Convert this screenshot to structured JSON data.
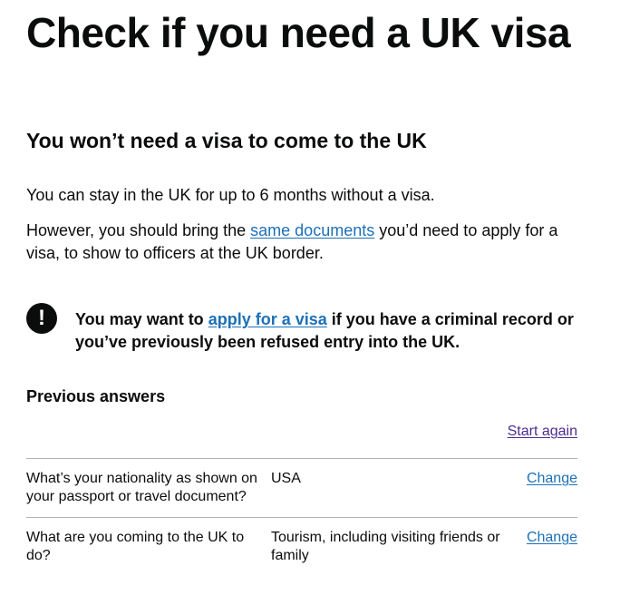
{
  "page": {
    "title": "Check if you need a UK visa"
  },
  "outcome": {
    "title": "You won’t need a visa to come to the UK",
    "paragraph1": "You can stay in the UK for up to 6 months without a visa.",
    "paragraph2_before": "However, you should bring the ",
    "paragraph2_link": "same documents",
    "paragraph2_after": " you’d need to apply for a visa, to show to officers at the UK border."
  },
  "warning": {
    "icon": "exclamation-icon",
    "icon_glyph": "!",
    "text_before": "You may want to ",
    "link": "apply for a visa",
    "text_after": " if you have a criminal record or you’ve previously been refused entry into the UK."
  },
  "previous_answers": {
    "title": "Previous answers",
    "start_again": "Start again",
    "rows": [
      {
        "question": "What’s your nationality as shown on your passport or travel document?",
        "answer": "USA",
        "change": "Change"
      },
      {
        "question": "What are you coming to the UK to do?",
        "answer": "Tourism, including visiting friends or family",
        "change": "Change"
      }
    ]
  },
  "colors": {
    "text": "#0b0c0c",
    "link": "#1d70b8",
    "visited_link": "#4c2c92",
    "border": "#b1b4b6"
  }
}
